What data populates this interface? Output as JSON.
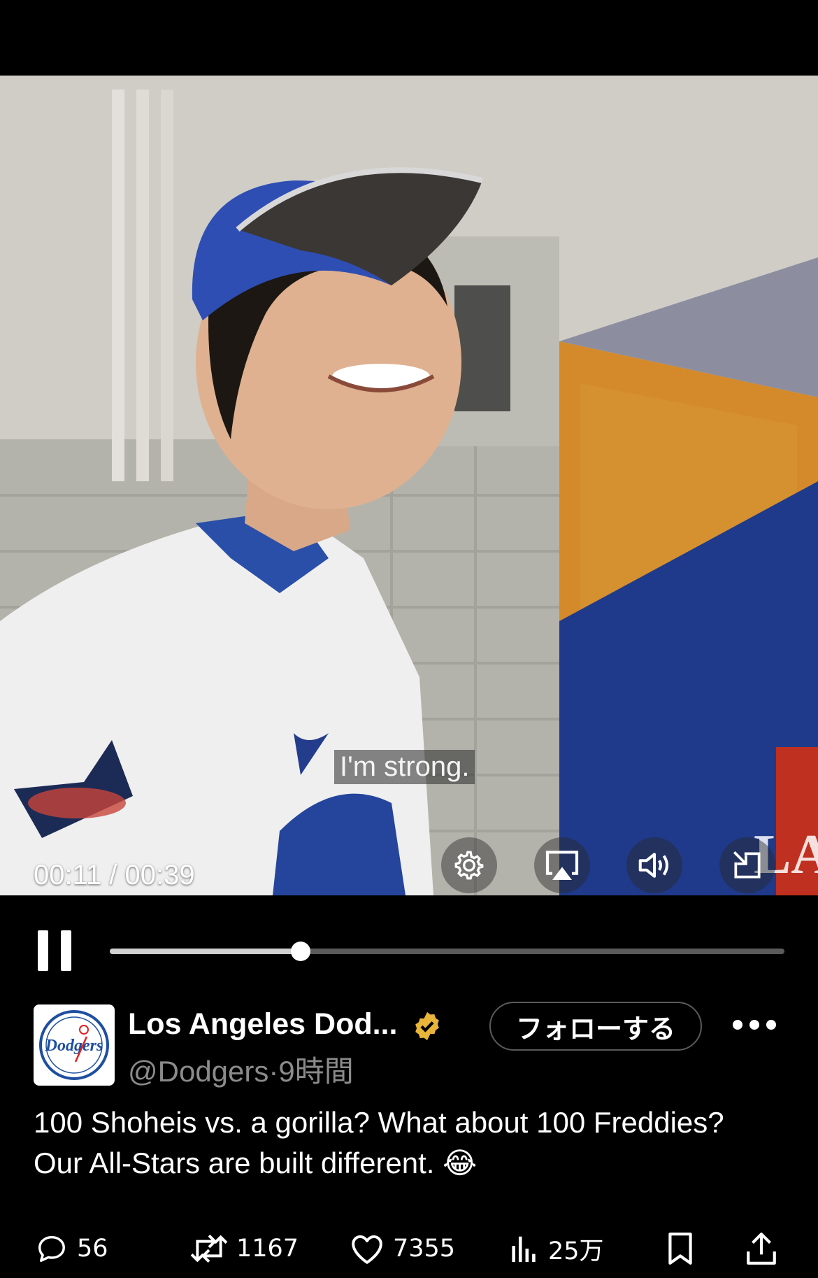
{
  "video": {
    "subtitle": "I'm strong.",
    "timecode": "00:11 / 00:39",
    "progress": 0.283,
    "watermark": "LA"
  },
  "post": {
    "display_name": "Los Angeles Dod...",
    "handle": "@Dodgers",
    "separator": "·",
    "time": "9時間",
    "follow_label": "フォローする",
    "avatar_text": "Dodgers",
    "text_line1": "100 Shoheis vs. a gorilla? What about 100 Freddies?",
    "text_line2": "Our All-Stars are built different. 😂",
    "verified_color": "#e8b53a"
  },
  "actions": {
    "replies": "56",
    "reposts": "1167",
    "likes": "7355",
    "views": "25万"
  },
  "icons": [
    "settings-icon",
    "airplay-icon",
    "volume-icon",
    "exit-fullscreen-icon",
    "pause-icon",
    "reply-icon",
    "repost-icon",
    "like-icon",
    "views-icon",
    "bookmark-icon",
    "share-icon",
    "more-icon",
    "verified-badge-icon"
  ]
}
